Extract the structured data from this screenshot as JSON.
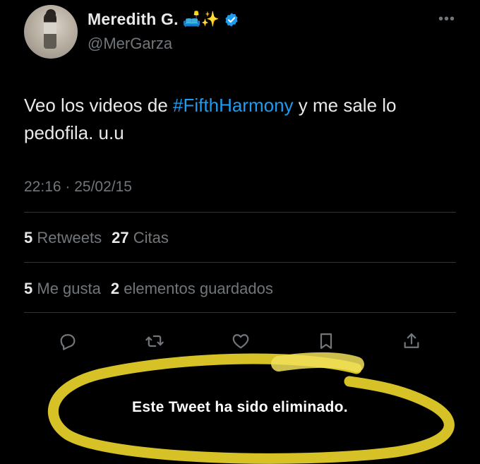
{
  "user": {
    "name": "Meredith G.",
    "emoji": "🛋️✨",
    "handle": "@MerGarza"
  },
  "more_label": "•••",
  "tweet": {
    "text_before": "Veo los videos de ",
    "hashtag": "#FifthHarmony",
    "text_after": " y me sale lo pedofila. u.u",
    "timestamp": "22:16 · 25/02/15"
  },
  "stats": {
    "retweets_count": "5",
    "retweets_label": "Retweets",
    "quotes_count": "27",
    "quotes_label": "Citas",
    "likes_count": "5",
    "likes_label": "Me gusta",
    "bookmarks_count": "2",
    "bookmarks_label": "elementos guardados"
  },
  "actions": [
    "reply-icon",
    "retweet-icon",
    "like-icon",
    "bookmark-icon",
    "share-icon"
  ],
  "deleted_notice": "Este Tweet ha sido eliminado.",
  "colors": {
    "background": "#000000",
    "accent": "#1d9bf0",
    "highlight": "#e8d22a",
    "muted": "#71767b"
  }
}
